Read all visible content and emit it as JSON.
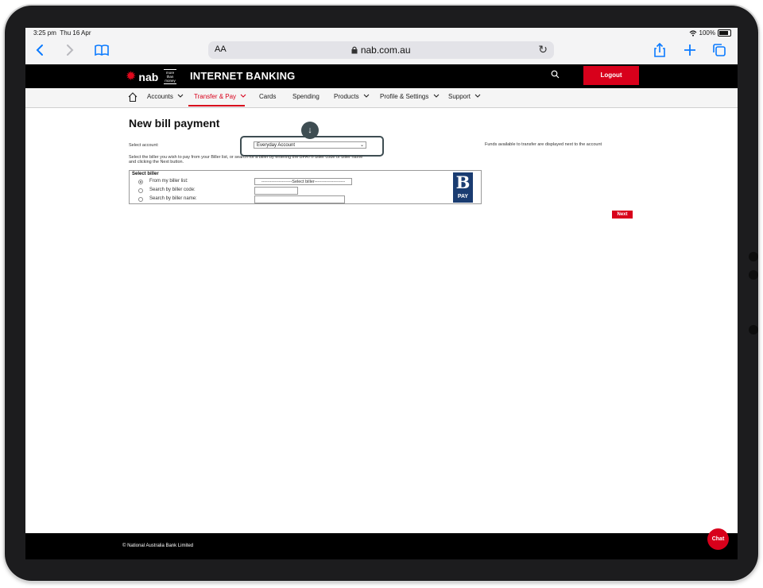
{
  "status_bar": {
    "time": "3:25 pm",
    "date": "Thu 16 Apr",
    "battery": "100%"
  },
  "safari": {
    "text_size": "AA",
    "url": "nab.com.au"
  },
  "header": {
    "brand": "nab",
    "tagline": [
      "more",
      "than",
      "money"
    ],
    "title": "INTERNET BANKING",
    "logout_label": "Logout"
  },
  "nav": {
    "items": [
      {
        "label": "Accounts",
        "has_dropdown": true
      },
      {
        "label": "Transfer & Pay",
        "has_dropdown": true,
        "active": true
      },
      {
        "label": "Cards",
        "has_dropdown": false
      },
      {
        "label": "Spending",
        "has_dropdown": false
      },
      {
        "label": "Products",
        "has_dropdown": true
      },
      {
        "label": "Profile & Settings",
        "has_dropdown": true
      },
      {
        "label": "Support",
        "has_dropdown": true
      }
    ]
  },
  "page": {
    "title": "New bill payment",
    "select_account_label": "Select account:",
    "selected_account": "Everyday Account",
    "funds_note": "Funds available to transfer are displayed next to the account",
    "instructions": "Select the biller you wish to pay from your Biller list, or search for a biller by entering the BPAY® biller code or biller name and clicking the Next button.",
    "biller_section": {
      "heading": "Select biller",
      "options": [
        {
          "label": "From my biller list:",
          "checked": true
        },
        {
          "label": "Search by biller code:",
          "checked": false
        },
        {
          "label": "Search by biller name:",
          "checked": false
        }
      ],
      "biller_select_value": "---------------------Select biller---------------------",
      "bpay_logo": {
        "letter": "B",
        "word": "PAY"
      }
    },
    "next_label": "Next"
  },
  "footer": {
    "copyright": "© National Australia Bank Limited"
  },
  "chat_label": "Chat",
  "colors": {
    "brand_red": "#d8001b",
    "header_black": "#000000",
    "bpay_blue": "#1a3c71",
    "focus_ring": "#3e4d52",
    "safari_blue": "#0a7aff"
  }
}
